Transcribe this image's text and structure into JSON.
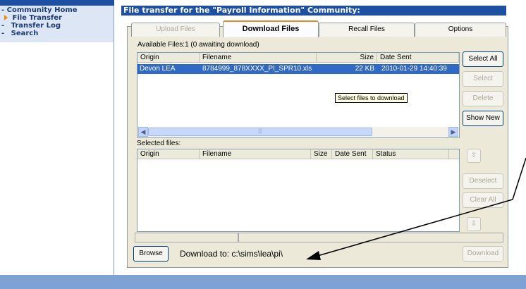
{
  "nav": {
    "items": [
      {
        "prefix": "-",
        "label": "Community Home"
      },
      {
        "prefix": "",
        "label": "File Transfer"
      },
      {
        "prefix": "-",
        "label": "Transfer Log"
      },
      {
        "prefix": "-",
        "label": "Search"
      }
    ]
  },
  "header": {
    "title": "File transfer for the \"Payroll Information\" Community:"
  },
  "tabs": [
    {
      "label": "Upload Files",
      "state": "disabled"
    },
    {
      "label": "Download Files",
      "state": "active"
    },
    {
      "label": "Recall Files",
      "state": "normal"
    },
    {
      "label": "Options",
      "state": "normal"
    }
  ],
  "available": {
    "label": "Available Files:1 (0 awaiting download)",
    "columns": [
      "Origin",
      "Filename",
      "Size",
      "Date Sent"
    ],
    "rows": [
      {
        "origin": "Devon LEA",
        "filename": "8784999_878XXXX_PI_SPR10.xls",
        "size": "22 KB",
        "date_sent": "2010-01-29 14:40:39"
      }
    ],
    "tooltip": "Select files to download"
  },
  "selected": {
    "label": "Selected files:",
    "columns": [
      "Origin",
      "Filename",
      "Size",
      "Date Sent",
      "Status"
    ]
  },
  "buttons": {
    "select_all": "Select All",
    "select": "Select",
    "delete": "Delete",
    "show_new": "Show New",
    "deselect": "Deselect",
    "clear_all": "Clear All",
    "browse": "Browse",
    "download": "Download"
  },
  "download_to": "Download to: c:\\sims\\lea\\pi\\",
  "colors": {
    "header_bg": "#1d4fa3",
    "nav_text": "#1b3a7a",
    "selection": "#316ac5",
    "footer": "#7ea2d4",
    "tab_highlight": "#e68b2c"
  }
}
